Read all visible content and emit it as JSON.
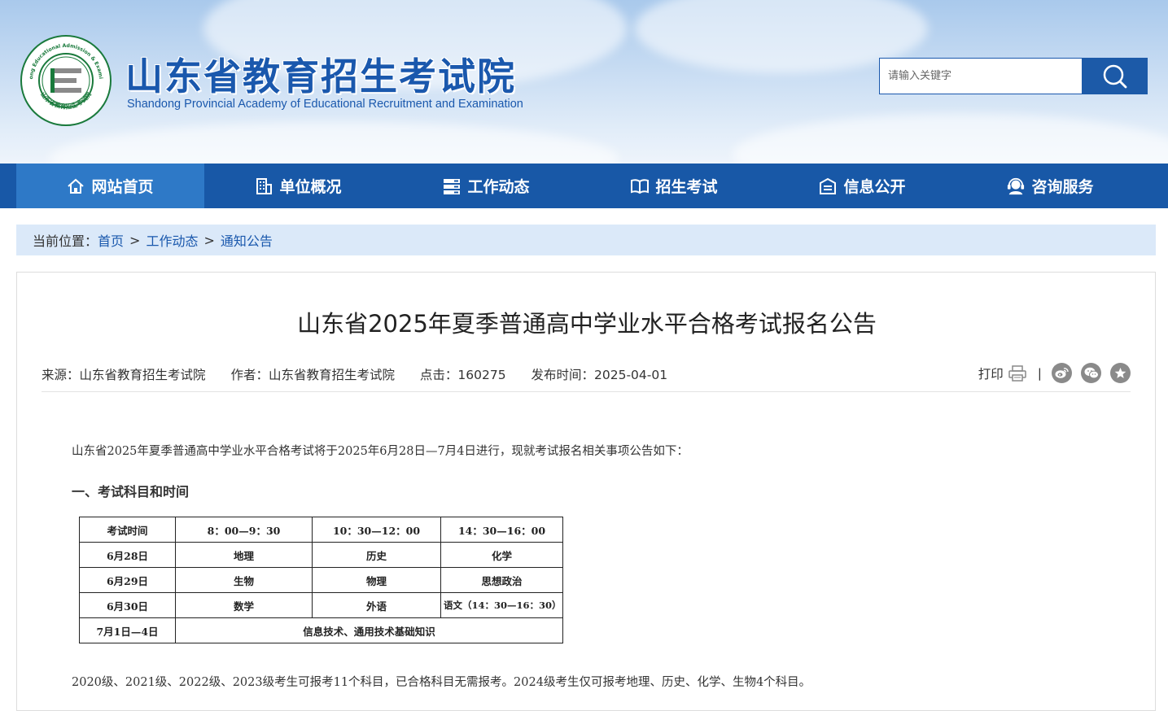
{
  "header": {
    "title": "山东省教育招生考试院",
    "subtitle": "Shandong Provincial Academy of Educational Recruitment and Examination",
    "emblem_ring_text": "Shandong Educational Admission & Examination",
    "emblem_bottom_text": "山东省教育招生考试院",
    "search_placeholder": "请输入关键字",
    "search_icon": "search-icon"
  },
  "nav": {
    "items": [
      {
        "label": "网站首页",
        "icon": "home-icon",
        "active": true
      },
      {
        "label": "单位概况",
        "icon": "building-icon"
      },
      {
        "label": "工作动态",
        "icon": "stack-icon"
      },
      {
        "label": "招生考试",
        "icon": "book-icon"
      },
      {
        "label": "信息公开",
        "icon": "inbox-icon"
      },
      {
        "label": "咨询服务",
        "icon": "headset-icon"
      }
    ]
  },
  "breadcrumb": {
    "prefix": "当前位置：",
    "items": [
      "首页",
      "工作动态",
      "通知公告"
    ],
    "separator": ">"
  },
  "article": {
    "title": "山东省2025年夏季普通高中学业水平合格考试报名公告",
    "source": "来源：山东省教育招生考试院",
    "author": "作者：山东省教育招生考试院",
    "clicks": "点击：160275",
    "published": "发布时间：2025-04-01",
    "print_label": "打印",
    "share_divider": "|",
    "share_icons": [
      "weibo-icon",
      "wechat-icon",
      "favorite-icon"
    ],
    "intro": "山东省2025年夏季普通高中学业水平合格考试将于2025年6月28日—7月4日进行，现就考试报名相关事项公告如下：",
    "section1_heading": "一、考试科目和时间",
    "schedule": {
      "header": [
        "考试时间",
        "8：00—9：30",
        "10：30—12：00",
        "14：30—16：00"
      ],
      "rows": [
        [
          "6月28日",
          "地理",
          "历史",
          "化学"
        ],
        [
          "6月29日",
          "生物",
          "物理",
          "思想政治"
        ],
        [
          "6月30日",
          "数学",
          "外语",
          "语文（14：30—16：30）"
        ]
      ],
      "last_row": [
        "7月1日—4日",
        "信息技术、通用技术基础知识"
      ]
    },
    "note": "2020级、2021级、2022级、2023级考生可报考11个科目，已合格科目无需报考。2024级考生仅可报考地理、历史、化学、生物4个科目。"
  },
  "colors": {
    "brand_blue": "#1a58ad",
    "nav_bg": "#1858a7",
    "nav_active": "#2e79c7",
    "breadcrumb_bg": "#dbe9f9",
    "emblem_green": "#1a7a3c"
  }
}
